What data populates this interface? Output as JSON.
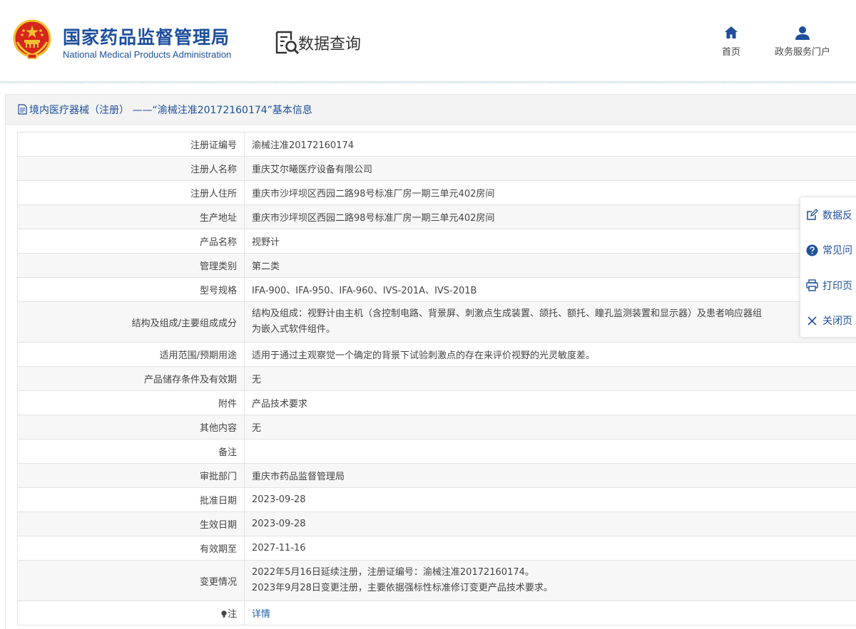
{
  "header": {
    "logo_cn": "国家药品监督管理局",
    "logo_en": "National Medical Products Administration",
    "section_title": "数据查询",
    "nav": [
      {
        "label": "首页",
        "icon": "home-icon"
      },
      {
        "label": "政务服务门户",
        "icon": "user-icon"
      }
    ]
  },
  "panel": {
    "heading": "境内医疗器械（注册）  ——“渝械注准20172160174”基本信息"
  },
  "rows": [
    {
      "label": "注册证编号",
      "value": "渝械注准20172160174"
    },
    {
      "label": "注册人名称",
      "value": "重庆艾尔曦医疗设备有限公司"
    },
    {
      "label": "注册人住所",
      "value": "重庆市沙坪坝区西园二路98号标准厂房一期三单元402房间"
    },
    {
      "label": "生产地址",
      "value": "重庆市沙坪坝区西园二路98号标准厂房一期三单元402房间"
    },
    {
      "label": "产品名称",
      "value": "视野计"
    },
    {
      "label": "管理类别",
      "value": "第二类"
    },
    {
      "label": "型号规格",
      "value": "IFA-900、IFA-950、IFA-960、IVS-201A、IVS-201B"
    },
    {
      "label": "结构及组成/主要组成成分",
      "value_lines": [
        "结构及组成：视野计由主机（含控制电路、背景屏、刺激点生成装置、颌托、额托、瞳孔监测装置和显示器）及患者响应器组",
        "为嵌入式软件组件。"
      ]
    },
    {
      "label": "适用范围/预期用途",
      "value": "适用于通过主观察觉一个确定的背景下试验刺激点的存在来评价视野的光灵敏度差。"
    },
    {
      "label": "产品储存条件及有效期",
      "value": "无"
    },
    {
      "label": "附件",
      "value": "产品技术要求"
    },
    {
      "label": "其他内容",
      "value": "无"
    },
    {
      "label": "备注",
      "value": ""
    },
    {
      "label": "审批部门",
      "value": "重庆市药品监督管理局"
    },
    {
      "label": "批准日期",
      "value": "2023-09-28"
    },
    {
      "label": "生效日期",
      "value": "2023-09-28"
    },
    {
      "label": "有效期至",
      "value": "2027-11-16"
    },
    {
      "label": "变更情况",
      "value_lines": [
        "2022年5月16日延续注册，注册证编号：渝械注准20172160174。",
        "2023年9月28日变更注册，主要依据强标性标准修订变更产品技术要求。"
      ]
    },
    {
      "label": "注",
      "value": "详情"
    }
  ],
  "side_panel": [
    {
      "label": "数据反",
      "icon": "edit-icon"
    },
    {
      "label": "常见问",
      "icon": "help-icon"
    },
    {
      "label": "打印页",
      "icon": "print-icon"
    },
    {
      "label": "关闭页",
      "icon": "close-icon"
    }
  ],
  "colors": {
    "brand": "#1e4f9c",
    "emblem_red": "#d7261b",
    "emblem_gold": "#f2c230",
    "border": "#e3e3e3"
  }
}
